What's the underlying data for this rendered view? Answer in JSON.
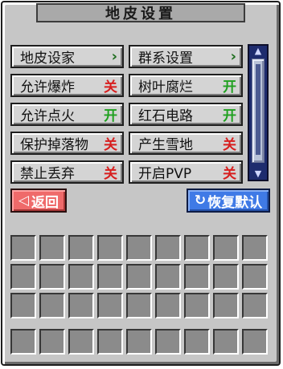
{
  "title": "地皮设置",
  "rows": [
    {
      "left": {
        "label": "地皮设家",
        "kind": "arrow",
        "value": "›"
      },
      "right": {
        "label": "群系设置",
        "kind": "arrow",
        "value": "›"
      }
    },
    {
      "left": {
        "label": "允许爆炸",
        "kind": "off",
        "value": "关"
      },
      "right": {
        "label": "树叶腐烂",
        "kind": "on",
        "value": "开"
      }
    },
    {
      "left": {
        "label": "允许点火",
        "kind": "on",
        "value": "开"
      },
      "right": {
        "label": "红石电路",
        "kind": "on",
        "value": "开"
      }
    },
    {
      "left": {
        "label": "保护掉落物",
        "kind": "off",
        "value": "关"
      },
      "right": {
        "label": "产生雪地",
        "kind": "off",
        "value": "关"
      }
    },
    {
      "left": {
        "label": "禁止丢弃",
        "kind": "off",
        "value": "关"
      },
      "right": {
        "label": "开启PVP",
        "kind": "off",
        "value": "关"
      }
    }
  ],
  "back_label": "返回",
  "reset_label": "恢复默认",
  "colors": {
    "on": "#1fa01f",
    "off": "#d81e1e",
    "back": "#ef6a6a",
    "reset": "#3f7ae6"
  }
}
